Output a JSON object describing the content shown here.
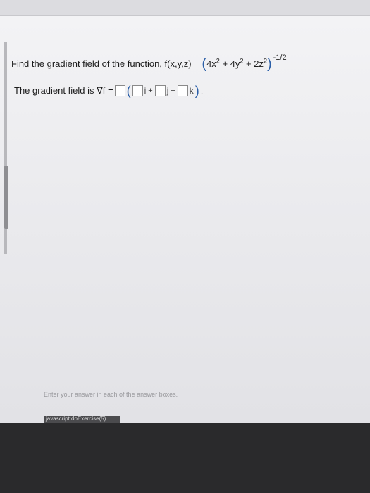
{
  "question": {
    "prompt": "Find the gradient field of the function, f(x,y,z) =",
    "term_x": "4x",
    "term_y": "+ 4y",
    "term_z": "+ 2z",
    "power": "2",
    "exponent": "-1/2"
  },
  "answer": {
    "label": "The gradient field is ∇f =",
    "unit_i": "i",
    "unit_j": "j",
    "unit_k": "k",
    "plus": "+"
  },
  "footer": {
    "hint": "Enter your answer in each of the answer boxes.",
    "js_link": "javascript:doExercise(5)"
  }
}
